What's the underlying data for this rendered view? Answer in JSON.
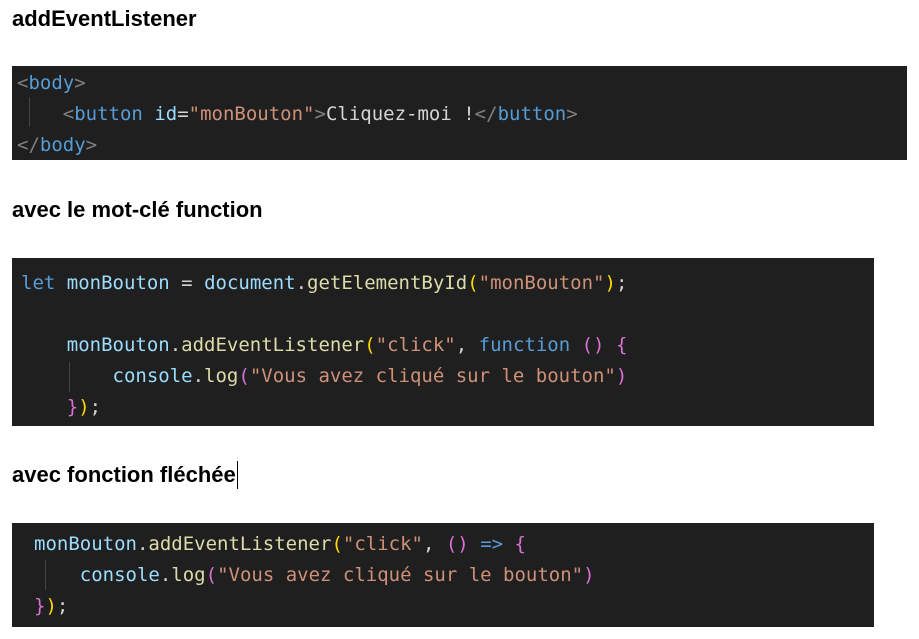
{
  "headings": {
    "h1": "addEventListener",
    "h2": "avec le mot-clé function",
    "h3": "avec fonction fléchée"
  },
  "html_block": {
    "line1": {
      "lt": "<",
      "tag": "body",
      "gt": ">"
    },
    "line2": {
      "indent": "    ",
      "lt": "<",
      "tag": "button",
      "sp": " ",
      "attr": "id",
      "eq": "=",
      "val": "\"monBouton\"",
      "gt": ">",
      "text": "Cliquez-moi !",
      "close_lt": "</",
      "close_tag": "button",
      "close_gt": ">"
    },
    "line3": {
      "lt": "</",
      "tag": "body",
      "gt": ">"
    }
  },
  "func_block": {
    "line1": {
      "kw": "let",
      "sp1": " ",
      "var": "monBouton",
      "op": " = ",
      "obj": "document",
      "dot": ".",
      "fn": "getElementById",
      "po": "(",
      "arg": "\"monBouton\"",
      "pc": ")",
      "semi": ";"
    },
    "line2": {
      "indent": "    ",
      "obj": "monBouton",
      "dot": ".",
      "fn": "addEventListener",
      "po": "(",
      "arg": "\"click\"",
      "comma": ", ",
      "kw": "function",
      "sp": " ",
      "params": "()",
      "sp2": " ",
      "brace": "{"
    },
    "line3": {
      "indent": "        ",
      "obj": "console",
      "dot": ".",
      "fn": "log",
      "po": "(",
      "arg": "\"Vous avez cliqué sur le bouton\"",
      "pc": ")"
    },
    "line4": {
      "indent": "    ",
      "brace": "}",
      "pc": ")",
      "semi": ";"
    }
  },
  "arrow_block": {
    "line1": {
      "obj": "monBouton",
      "dot": ".",
      "fn": "addEventListener",
      "po": "(",
      "arg": "\"click\"",
      "comma": ", ",
      "params": "()",
      "arrow": " => ",
      "brace": "{"
    },
    "line2": {
      "indent": "    ",
      "obj": "console",
      "dot": ".",
      "fn": "log",
      "po": "(",
      "arg": "\"Vous avez cliqué sur le bouton\"",
      "pc": ")"
    },
    "line3": {
      "brace": "}",
      "pc": ")",
      "semi": ";"
    }
  },
  "colors": {
    "code_background": "#1f1f1f",
    "tag": "#569cd6",
    "attribute": "#9cdcfe",
    "string": "#ce9178",
    "function": "#dcdcaa",
    "bracket_level1": "#ffd700",
    "bracket_level2": "#da70d6"
  }
}
